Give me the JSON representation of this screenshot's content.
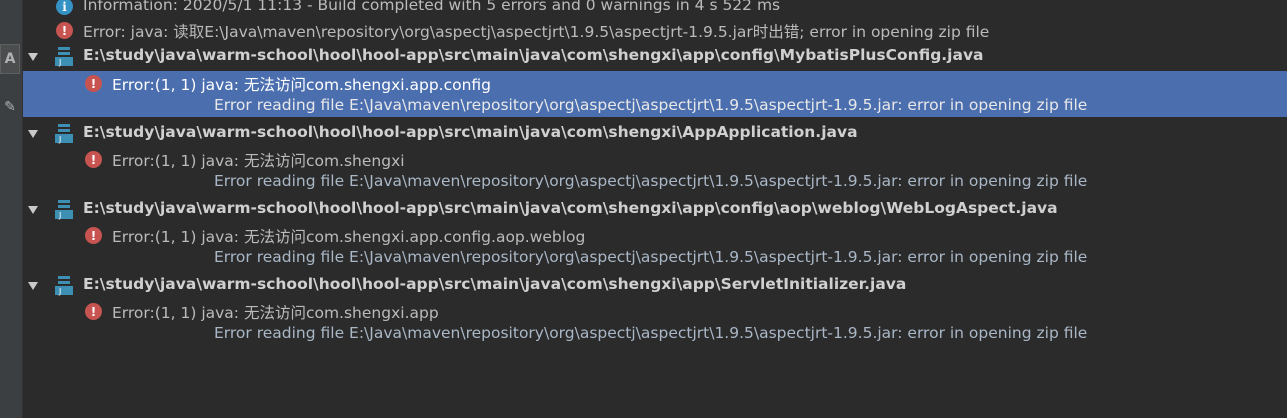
{
  "gutter": {
    "buttons": [
      "A",
      "✎"
    ]
  },
  "messages": [
    {
      "kind": "info",
      "text": "Information: 2020/5/1 11:13 - Build completed with 5 errors and 0 warnings in 4 s 522 ms"
    },
    {
      "kind": "error",
      "text": "Error: java: 读取E:\\Java\\maven\\repository\\org\\aspectj\\aspectjrt\\1.9.5\\aspectjrt-1.9.5.jar时出错; error in opening zip file"
    }
  ],
  "files": [
    {
      "path": "E:\\study\\java\\warm-school\\hool\\hool-app\\src\\main\\java\\com\\shengxi\\app\\config\\MybatisPlusConfig.java",
      "error": "Error:(1, 1)  java: 无法访问com.shengxi.app.config",
      "detail": "Error reading file E:\\Java\\maven\\repository\\org\\aspectj\\aspectjrt\\1.9.5\\aspectjrt-1.9.5.jar: error in opening zip file"
    },
    {
      "path": "E:\\study\\java\\warm-school\\hool\\hool-app\\src\\main\\java\\com\\shengxi\\AppApplication.java",
      "error": "Error:(1, 1)  java: 无法访问com.shengxi",
      "detail": "Error reading file E:\\Java\\maven\\repository\\org\\aspectj\\aspectjrt\\1.9.5\\aspectjrt-1.9.5.jar: error in opening zip file"
    },
    {
      "path": "E:\\study\\java\\warm-school\\hool\\hool-app\\src\\main\\java\\com\\shengxi\\app\\config\\aop\\weblog\\WebLogAspect.java",
      "error": "Error:(1, 1)  java: 无法访问com.shengxi.app.config.aop.weblog",
      "detail": "Error reading file E:\\Java\\maven\\repository\\org\\aspectj\\aspectjrt\\1.9.5\\aspectjrt-1.9.5.jar: error in opening zip file"
    },
    {
      "path": "E:\\study\\java\\warm-school\\hool\\hool-app\\src\\main\\java\\com\\shengxi\\app\\ServletInitializer.java",
      "error": "Error:(1, 1)  java: 无法访问com.shengxi.app",
      "detail": "Error reading file E:\\Java\\maven\\repository\\org\\aspectj\\aspectjrt\\1.9.5\\aspectjrt-1.9.5.jar: error in opening zip file"
    }
  ],
  "icons": {
    "info": "i",
    "error": "!",
    "file_label": "J"
  },
  "colors": {
    "background": "#2b2b2b",
    "selection": "#4b6eaf",
    "error": "#c75450",
    "info": "#3592c4",
    "file_icon": "#3d8fb4"
  }
}
